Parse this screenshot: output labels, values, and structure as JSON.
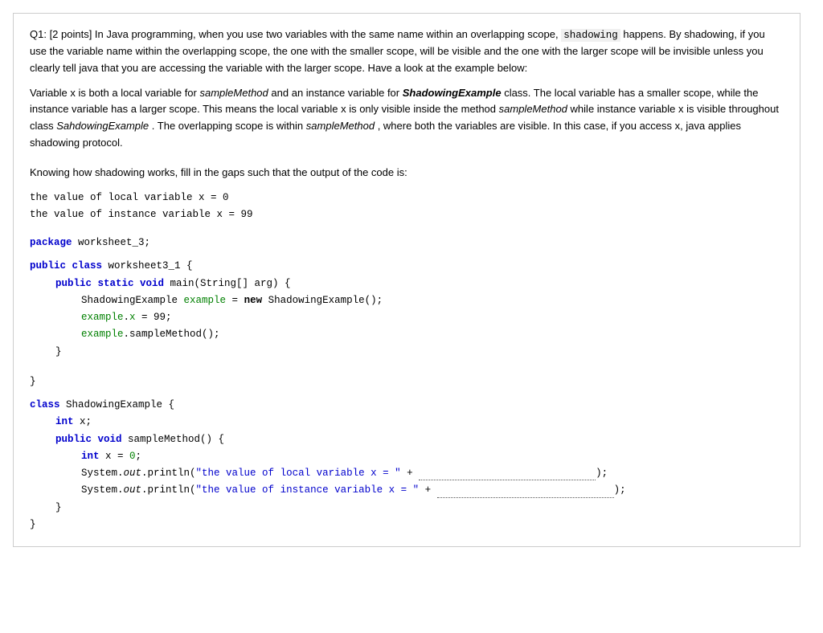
{
  "question": {
    "header": "Q1: [2 points] In Java programming, when you use two variables with the same name within an overlapping scope,",
    "inline_code_shadowing": "shadowing",
    "para1_rest": "happens. By shadowing, if you use the variable name within the overlapping scope, the one with the smaller scope, will be visible and the one with the larger scope will be invisible unless you clearly tell java that you are accessing the variable with the larger scope. Have a look at the example below:",
    "para2": "Variable x is both a local variable for",
    "italic1": "sampleMethod",
    "para2b": "and an instance variable for",
    "bold_italic1": "ShadowingExample",
    "para2c": "class. The local variable has a smaller scope, while the instance variable has a larger scope. This means the local variable x is only visible inside the method",
    "italic2": "sampleMethod",
    "para2d": "while instance variable x is visible throughout class",
    "italic3": "SahdowingExample",
    "para2e": ". The overlapping scope is within",
    "italic4": "sampleMethod",
    "para2f": ", where both the variables are visible. In this case, if you access x, java applies shadowing protocol.",
    "para3": "Knowing how shadowing works, fill in the gaps such that the output of the code is:",
    "output_line1": "the value of local variable x = 0",
    "output_line2": "the value of instance variable x = 99",
    "package_label": "package",
    "package_name": "worksheet_3;",
    "class_public": "public class",
    "class_name": "worksheet3_1",
    "main_sig": "public static void",
    "main_method": "main(String[] arg) {",
    "new_keyword": "new",
    "example_line": "ShadowingExample example = new ShadowingExample();",
    "example_x": "example.x = 99;",
    "example_call": "example.sampleMethod();",
    "class2": "class",
    "class2_name": "ShadowingExample {",
    "int_keyword": "int",
    "field_x": "x;",
    "void_keyword": "void",
    "sample_method_sig": "sampleMethod() {",
    "int_local": "int x = 0;",
    "println1_start": "System.",
    "out1": "out",
    "println1_mid": ".println(",
    "string1": "\"the value of local variable x = \"",
    "plus1": " +",
    "println2_start": "System.",
    "out2": "out",
    "println2_mid": ".println(",
    "string2": "\"the value of instance variable x = \"",
    "plus2": " +"
  }
}
